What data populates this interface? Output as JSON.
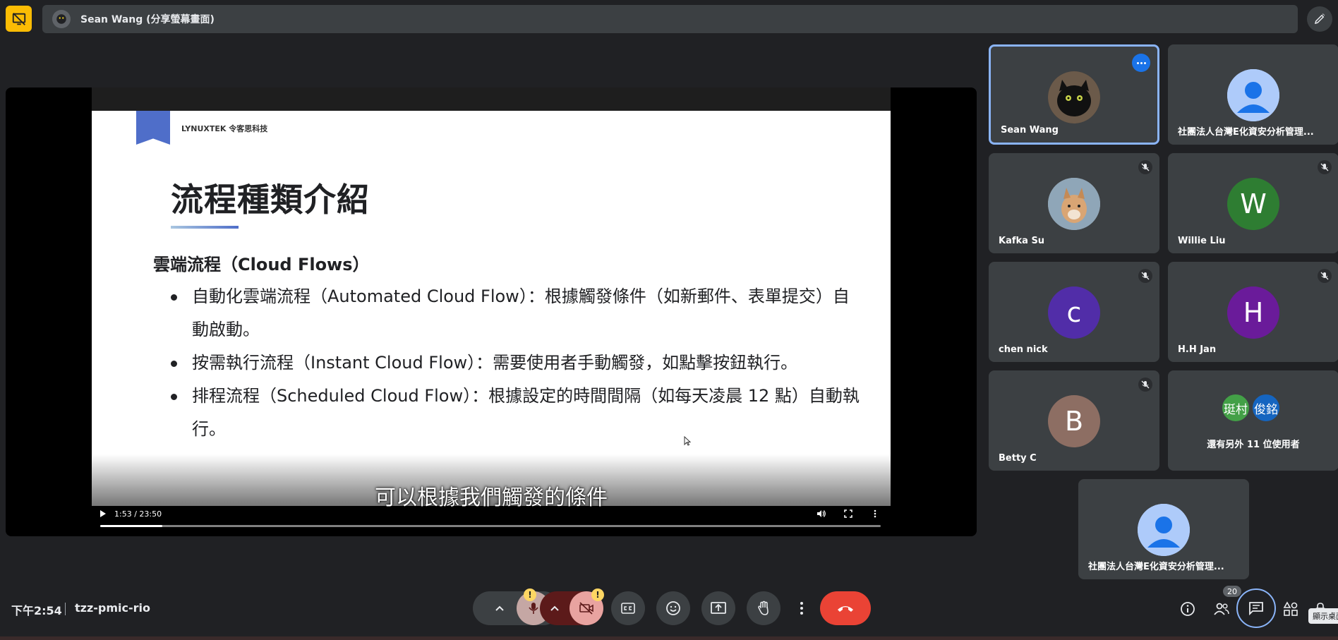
{
  "topbar": {
    "presenter_title": "Sean Wang (分享螢幕畫面)"
  },
  "slide": {
    "brand": "LYNUXTEK 令客思科技",
    "title": "流程種類介紹",
    "section_heading": "雲端流程（Cloud Flows）",
    "bullets": [
      "自動化雲端流程（Automated Cloud Flow）：根據觸發條件（如新郵件、表單提交）自動啟動。",
      "按需執行流程（Instant Cloud Flow）：需要使用者手動觸發，如點擊按鈕執行。",
      "排程流程（Scheduled Cloud Flow）：根據設定的時間間隔（如每天凌晨 12 點）自動執行。"
    ]
  },
  "video": {
    "caption": "可以根據我們觸發的條件",
    "time": "1:53 / 23:50",
    "progress_fraction": 0.08
  },
  "participants": [
    {
      "name": "Sean Wang",
      "avatar": "photo-cat"
    },
    {
      "name": "社團法人台灣E化資安分析管理...",
      "avatar": "default-person"
    },
    {
      "name": "Kafka Su",
      "avatar": "photo-dog"
    },
    {
      "name": "Willie Liu",
      "avatar_letter": "W",
      "color": "#2e7d32"
    },
    {
      "name": "chen nick",
      "avatar_letter": "c",
      "color": "#512da8"
    },
    {
      "name": "H.H Jan",
      "avatar_letter": "H",
      "color": "#6a1b9a"
    },
    {
      "name": "Betty C",
      "avatar_letter": "B",
      "color": "#8d6e63"
    },
    {
      "name": "社團法人台灣E化資安分析管理...",
      "avatar": "default-person"
    }
  ],
  "others": {
    "avatars": [
      {
        "label": "珽村",
        "color": "#43a047"
      },
      {
        "label": "俊銘",
        "color": "#1565c0"
      }
    ],
    "text": "還有另外 11 位使用者"
  },
  "bottombar": {
    "clock": "下午2:54",
    "meeting_code": "tzz-pmic-rio",
    "alert_mark": "!",
    "people_count": "20",
    "tooltip": "顯示桌面"
  },
  "colors": {
    "background": "#202124",
    "tile": "#3c4043",
    "active_border": "#8ab4f8",
    "end_call": "#ea4335",
    "alert": "#fdd663",
    "accent_yellow": "#fbbc04"
  }
}
